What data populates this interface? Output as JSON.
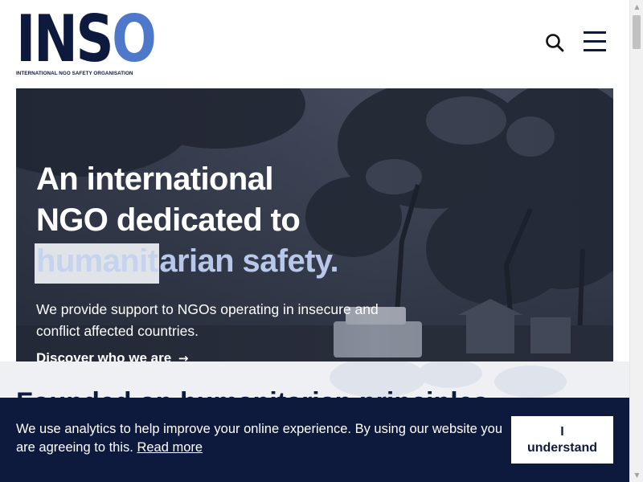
{
  "header": {
    "logo": {
      "letters_main": "INS",
      "letters_accent": "O",
      "tagline": "INTERNATIONAL NGO SAFETY ORGANISATION"
    },
    "search_icon": "search-icon",
    "menu_icon": "hamburger-menu-icon"
  },
  "hero": {
    "title_line1": "An international",
    "title_line2": "NGO dedicated to",
    "title_line3_highlight": "humanit",
    "title_line3_rest": "arian safety.",
    "subtitle": "We provide support to NGOs operating in insecure and conflict affected countries.",
    "link_label": "Discover who we are",
    "link_arrow": "→"
  },
  "main": {
    "heading_partial": "Founded on humanitarian principles"
  },
  "cookie_banner": {
    "text": "We use analytics to help improve your online experience. By using our website you are agreeing to this.",
    "read_more": "Read more",
    "button_line1": "I",
    "button_line2": "understand"
  },
  "colors": {
    "navy": "#0e1a3d",
    "accent_blue": "#4e78c9",
    "hero_accent": "#b8c8ea"
  }
}
